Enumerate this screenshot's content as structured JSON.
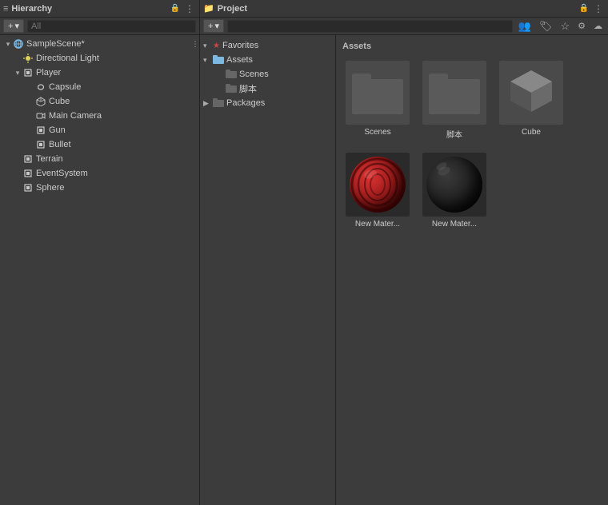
{
  "hierarchy": {
    "title": "Hierarchy",
    "search_placeholder": "All",
    "add_label": "+",
    "scene": {
      "name": "SampleScene*",
      "children": [
        {
          "name": "Directional Light",
          "type": "light",
          "indent": 1
        },
        {
          "name": "Player",
          "type": "gameobj",
          "indent": 1,
          "expanded": true,
          "children": [
            {
              "name": "Capsule",
              "type": "gameobj",
              "indent": 2
            },
            {
              "name": "Cube",
              "type": "gameobj",
              "indent": 2
            },
            {
              "name": "Main Camera",
              "type": "camera",
              "indent": 2
            },
            {
              "name": "Gun",
              "type": "gameobj",
              "indent": 2
            },
            {
              "name": "Bullet",
              "type": "gameobj",
              "indent": 2
            }
          ]
        },
        {
          "name": "Terrain",
          "type": "terrain",
          "indent": 1
        },
        {
          "name": "EventSystem",
          "type": "gameobj",
          "indent": 1
        },
        {
          "name": "Sphere",
          "type": "gameobj",
          "indent": 1
        }
      ]
    }
  },
  "project": {
    "title": "Project",
    "search_placeholder": "",
    "add_label": "+",
    "sidebar": {
      "favorites": {
        "label": "Favorites",
        "expanded": true
      },
      "assets": {
        "label": "Assets",
        "expanded": true,
        "children": [
          {
            "name": "Scenes"
          },
          {
            "name": "脚本"
          }
        ]
      },
      "packages": {
        "label": "Packages",
        "expanded": false
      }
    },
    "assets_area": {
      "title": "Assets",
      "items": [
        {
          "name": "Scenes",
          "type": "folder"
        },
        {
          "name": "脚本",
          "type": "folder"
        },
        {
          "name": "Cube",
          "type": "cube"
        },
        {
          "name": "New Mater...",
          "type": "material_red"
        },
        {
          "name": "New Mater...",
          "type": "material_black"
        }
      ]
    }
  }
}
